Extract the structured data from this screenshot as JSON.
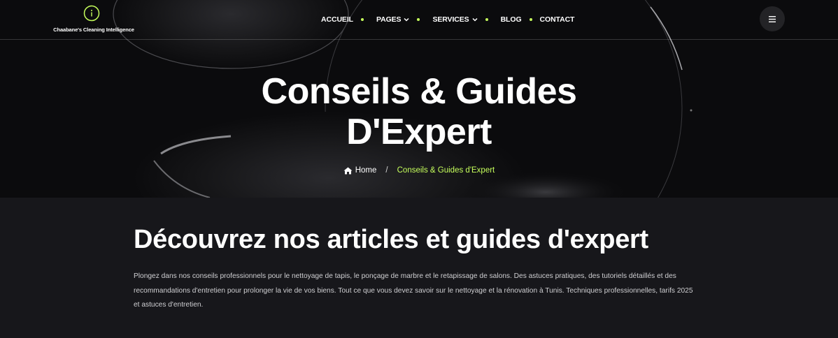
{
  "brand": {
    "name": "Chaabane's Cleaning Intelligence",
    "logo_icon": "circle-i-icon",
    "accent_color": "#c6ff5c"
  },
  "nav": {
    "items": [
      {
        "label": "ACCUEIL",
        "has_dropdown": false
      },
      {
        "label": "PAGES",
        "has_dropdown": true
      },
      {
        "label": "SERVICES",
        "has_dropdown": true
      },
      {
        "label": "BLOG",
        "has_dropdown": false
      },
      {
        "label": "CONTACT",
        "has_dropdown": false
      }
    ],
    "menu_icon": "hamburger-icon"
  },
  "hero": {
    "title_line1": "Conseils & Guides",
    "title_line2": "D'Expert",
    "breadcrumb": {
      "home_label": "Home",
      "home_icon": "home-icon",
      "separator": "/",
      "current": "Conseils & Guides d'Expert"
    }
  },
  "content": {
    "heading": "Découvrez nos articles et guides d'expert",
    "paragraph_line1": "Plongez dans nos conseils professionnels pour le nettoyage de tapis, le ponçage de marbre et le retapissage de salons. Des astuces pratiques, des tutoriels détaillés et des",
    "paragraph_line2": "recommandations d'entretien pour prolonger la vie de vos biens. Tout ce que vous devez savoir sur le nettoyage et la rénovation à Tunis. Techniques professionnelles, tarifs 2025",
    "paragraph_line3": "et astuces d'entretien."
  }
}
